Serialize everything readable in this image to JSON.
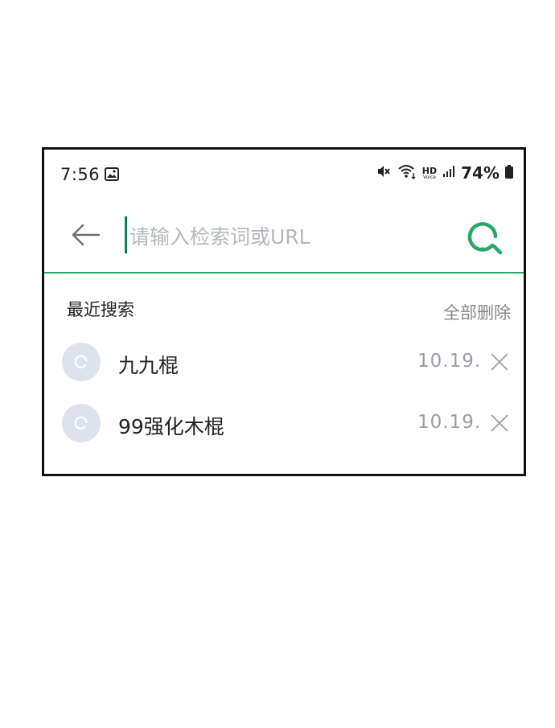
{
  "status_bar": {
    "time": "7:56",
    "battery": "74%",
    "icons": [
      "gallery-icon",
      "mute-icon",
      "wifi-icon",
      "hd-voice-icon",
      "signal-icon",
      "battery-icon"
    ],
    "hd_label": "HD",
    "voice_label": "Voice"
  },
  "search": {
    "placeholder": "请输入检索词或URL",
    "accent_color": "#2aa66b"
  },
  "recent": {
    "title": "最近搜索",
    "delete_all": "全部删除",
    "items": [
      {
        "text": "九九棍",
        "date": "10.19."
      },
      {
        "text": "99强化木棍",
        "date": "10.19."
      }
    ]
  }
}
